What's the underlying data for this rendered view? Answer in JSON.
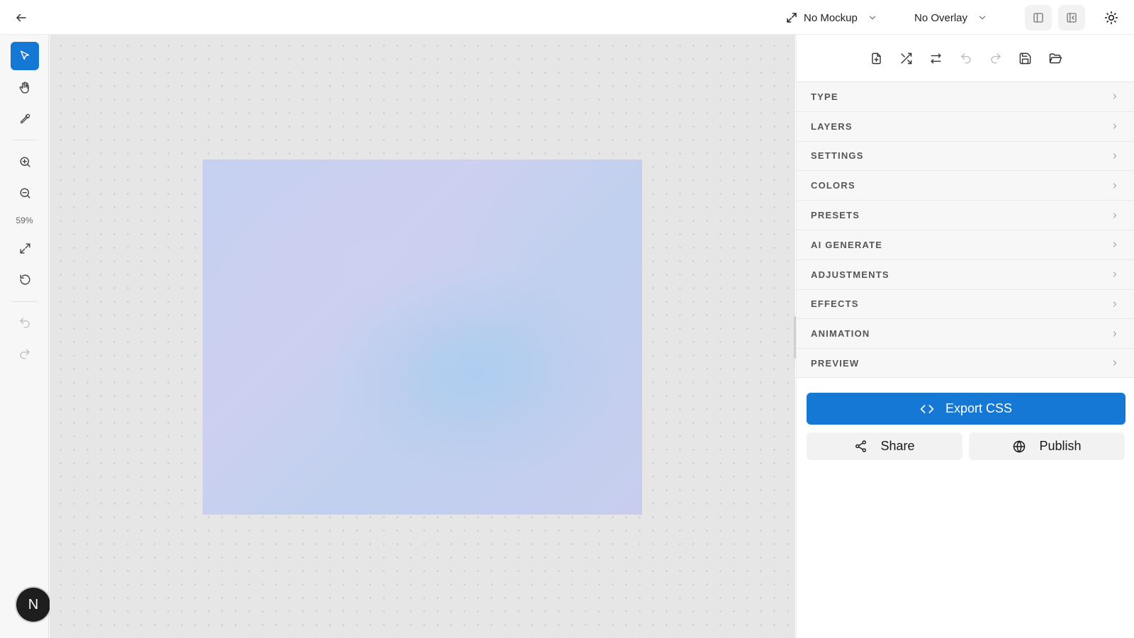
{
  "topbar": {
    "mockup_label": "No Mockup",
    "overlay_label": "No Overlay"
  },
  "left_toolbar": {
    "zoom_level": "59%"
  },
  "user": {
    "avatar_initial": "N"
  },
  "panel": {
    "sections": [
      "TYPE",
      "LAYERS",
      "SETTINGS",
      "COLORS",
      "PRESETS",
      "AI GENERATE",
      "ADJUSTMENTS",
      "EFFECTS",
      "ANIMATION",
      "PREVIEW"
    ],
    "export_label": "Export CSS",
    "share_label": "Share",
    "publish_label": "Publish"
  },
  "colors": {
    "accent": "#1478d4",
    "canvas_bg": "#e6e6e6",
    "artboard_gradient": [
      "#c5d0f1",
      "#cdd0f0",
      "#acceF0",
      "#c8cdee"
    ]
  },
  "icons": {
    "topbar": [
      "arrow-left-icon",
      "expand-icon",
      "chevron-down-icon",
      "panel-left-icon",
      "panel-collapse-icon",
      "sun-icon"
    ],
    "left_toolbar": [
      "cursor-icon",
      "hand-icon",
      "eyedropper-icon",
      "zoom-in-icon",
      "zoom-out-icon",
      "fit-screen-icon",
      "reset-icon",
      "undo-icon",
      "redo-icon"
    ],
    "panel_toolbar": [
      "new-file-icon",
      "shuffle-icon",
      "swap-icon",
      "undo-icon",
      "redo-icon",
      "save-icon",
      "open-folder-icon"
    ]
  }
}
